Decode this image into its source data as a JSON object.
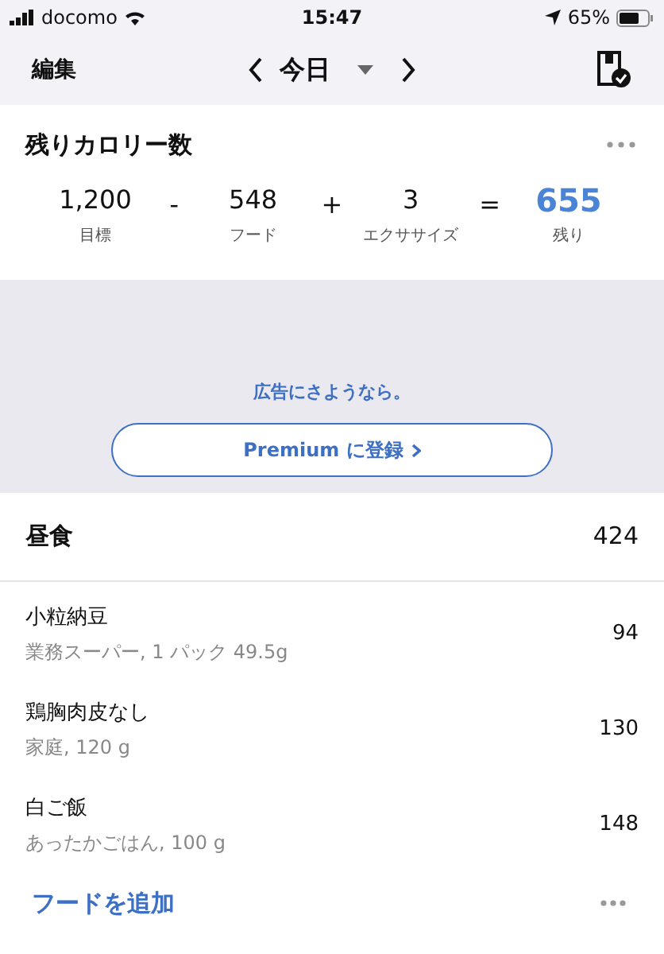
{
  "status_bar": {
    "carrier": "docomo",
    "time": "15:47",
    "battery": "65%"
  },
  "nav": {
    "edit": "編集",
    "date": "今日"
  },
  "calories": {
    "title": "残りカロリー数",
    "terms": [
      {
        "value": "1,200",
        "label": "目標",
        "kind": "term"
      },
      {
        "value": "-",
        "kind": "operator"
      },
      {
        "value": "548",
        "label": "フード",
        "kind": "term"
      },
      {
        "value": "+",
        "kind": "operator"
      },
      {
        "value": "3",
        "label": "エクササイズ",
        "kind": "term"
      },
      {
        "value": "=",
        "kind": "operator"
      },
      {
        "value": "655",
        "label": "残り",
        "kind": "result"
      }
    ]
  },
  "ad": {
    "message": "広告にさようなら。",
    "button": "Premium に登録"
  },
  "meal": {
    "title": "昼食",
    "total": "424",
    "items": [
      {
        "name": "小粒納豆",
        "detail": "業務スーパー, 1 パック 49.5g",
        "calories": "94"
      },
      {
        "name": "鶏胸肉皮なし",
        "detail": "家庭, 120 g",
        "calories": "130"
      },
      {
        "name": "白ご飯",
        "detail": "あったかごはん, 100 g",
        "calories": "148"
      }
    ],
    "add": "フードを追加"
  }
}
